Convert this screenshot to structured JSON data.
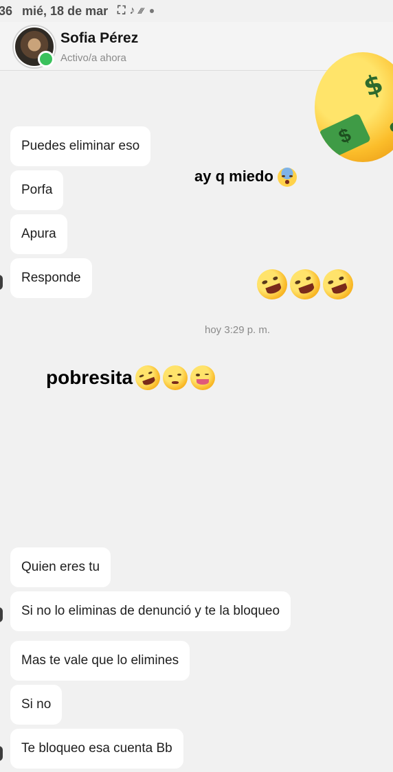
{
  "status_bar": {
    "time": "36",
    "date": "mié, 18 de mar"
  },
  "header": {
    "name": "Sofia Pérez",
    "status": "Activo/a ahora"
  },
  "messages_top": [
    {
      "text": "Puedes eliminar eso"
    },
    {
      "text": "Porfa"
    },
    {
      "text": "Apura"
    },
    {
      "text": "Responde"
    }
  ],
  "timestamp": "hoy 3:29 p. m.",
  "messages_bottom": [
    {
      "text": "Quien eres tu"
    },
    {
      "text": "Si no lo eliminas de denunció y te la bloqueo"
    },
    {
      "text": "Mas te vale que lo elimines"
    },
    {
      "text": "Si no"
    },
    {
      "text": "Te bloqueo esa cuenta Bb"
    }
  ],
  "overlays": {
    "caption1": "ay q miedo",
    "caption2": "pobresita"
  },
  "icons": {
    "status": [
      "screenshot-icon",
      "tiktok-icon",
      "signal-icon",
      "dot-icon"
    ],
    "emojis": [
      "fearful-face-icon",
      "rolling-laughing-icon",
      "woozy-face-icon",
      "tongue-wink-icon",
      "money-mouth-icon"
    ]
  }
}
